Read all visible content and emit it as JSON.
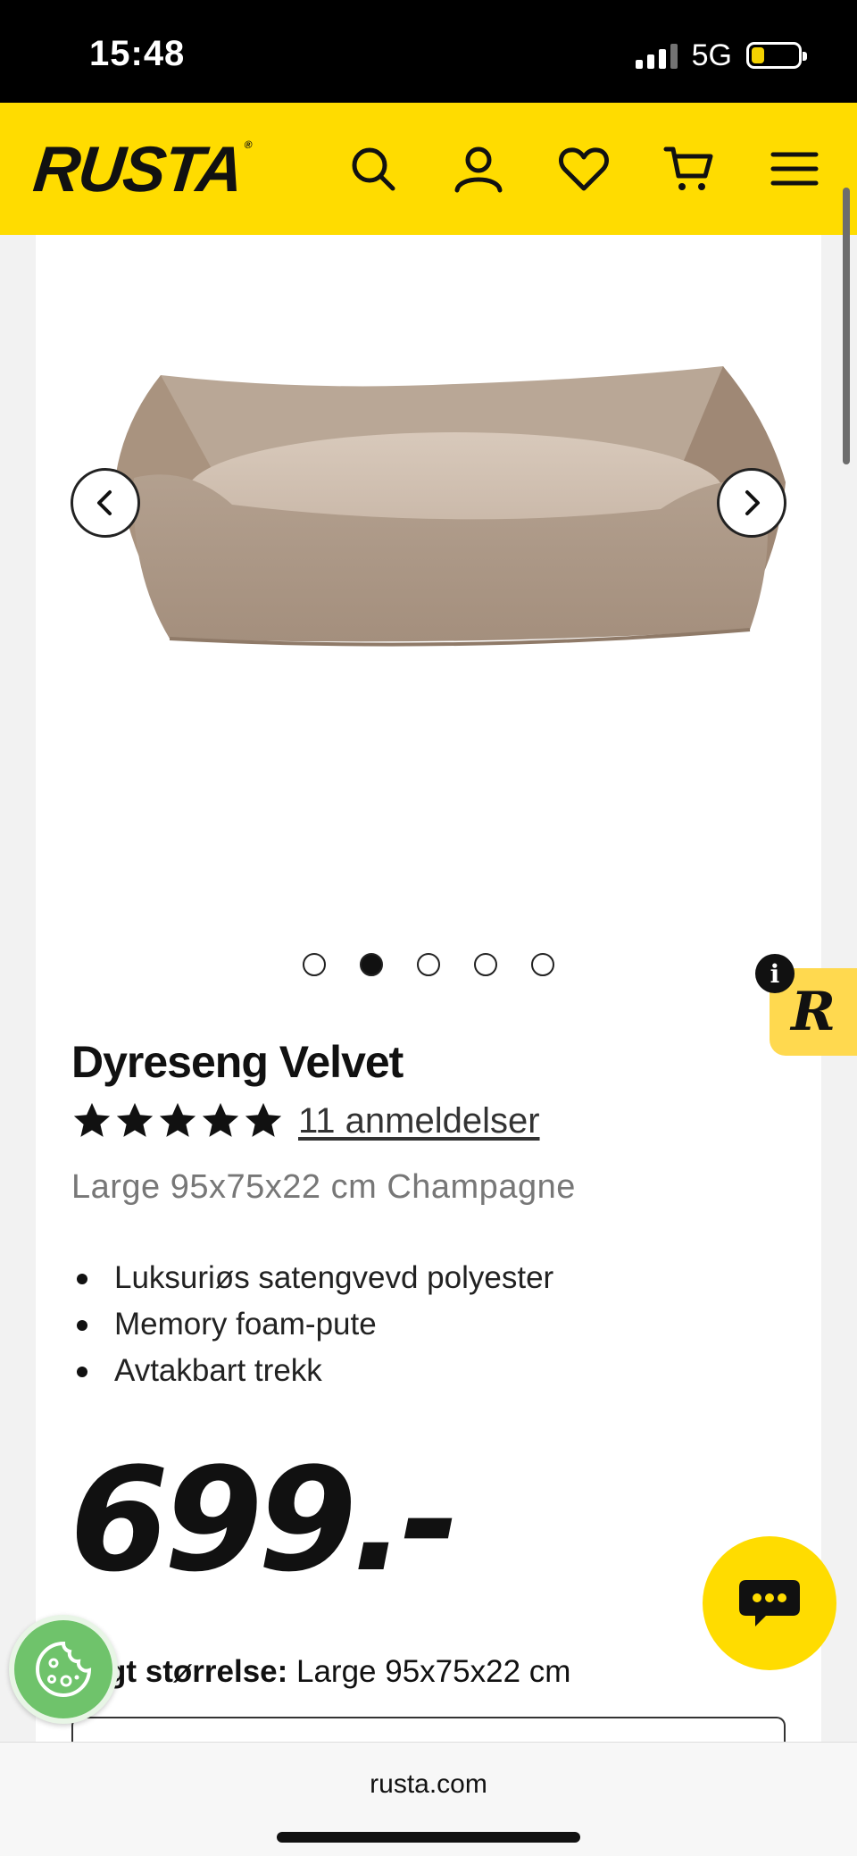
{
  "status": {
    "time": "15:48",
    "network": "5G"
  },
  "header": {
    "logo": "RUSTA",
    "brand_color": "#ffdc00",
    "icons": [
      "search-icon",
      "account-icon",
      "heart-icon",
      "cart-icon",
      "menu-icon"
    ]
  },
  "carousel": {
    "slides": 5,
    "active_index": 1
  },
  "badge": {
    "info": "i",
    "letter": "R"
  },
  "product": {
    "title": "Dyreseng Velvet",
    "rating": 5,
    "reviews_link": "11 anmeldelser",
    "variant": "Large 95x75x22 cm Champagne",
    "features": [
      "Luksuriøs satengvevd polyester",
      "Memory foam-pute",
      "Avtakbart trekk"
    ],
    "price": "699.-",
    "size_label": "gt størrelse:",
    "size_value": " Large 95x75x22 cm"
  },
  "browser": {
    "url": "rusta.com"
  }
}
